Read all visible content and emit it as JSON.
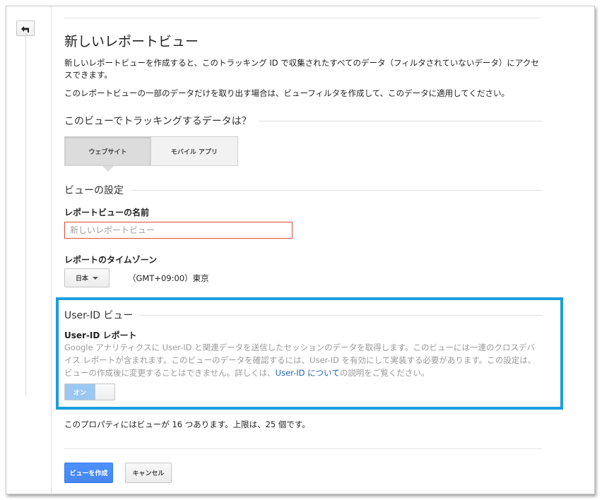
{
  "page": {
    "title": "新しいレポートビュー",
    "intro_paragraph": "新しいレポートビューを作成すると、このトラッキング ID で収集されたすべてのデータ（フィルタされていないデータ）にアクセスできます。",
    "filter_paragraph": "このレポートビューの一部のデータだけを取り出す場合は、ビューフィルタを作成して、このデータに適用してください。"
  },
  "tracking": {
    "section_title": "このビューでトラッキングするデータは？",
    "options": [
      {
        "label": "ウェブサイト",
        "selected": true
      },
      {
        "label": "モバイル アプリ",
        "selected": false
      }
    ]
  },
  "view_settings": {
    "section_title": "ビューの設定",
    "name_label": "レポートビューの名前",
    "name_placeholder": "新しいレポートビュー",
    "timezone_label": "レポートのタイムゾーン",
    "timezone_country": "日本",
    "timezone_value": "（GMT+09:00）東京"
  },
  "user_id": {
    "section_title": "User-ID ビュー",
    "report_label": "User-ID レポート",
    "description_before_link": "Google アナリティクスに User-ID と関連データを送信したセッションのデータを取得します。このビューには一連のクロスデバイス レポートが含まれます。このビューのデータを確認するには、User-ID を有効にして実装する必要があります。この設定は、ビューの作成後に変更することはできません。詳しくは、",
    "description_link": "User-ID について",
    "description_after_link": "の説明をご覧ください。",
    "toggle_label": "オン",
    "toggle_state": "on",
    "highlight_color": "#1a9fdd"
  },
  "limit_text": "このプロパティにはビューが 16 つあります。上限は、25 個です。",
  "actions": {
    "create_label": "ビューを作成",
    "cancel_label": "キャンセル"
  },
  "icons": {
    "back": "back-arrow-icon"
  }
}
